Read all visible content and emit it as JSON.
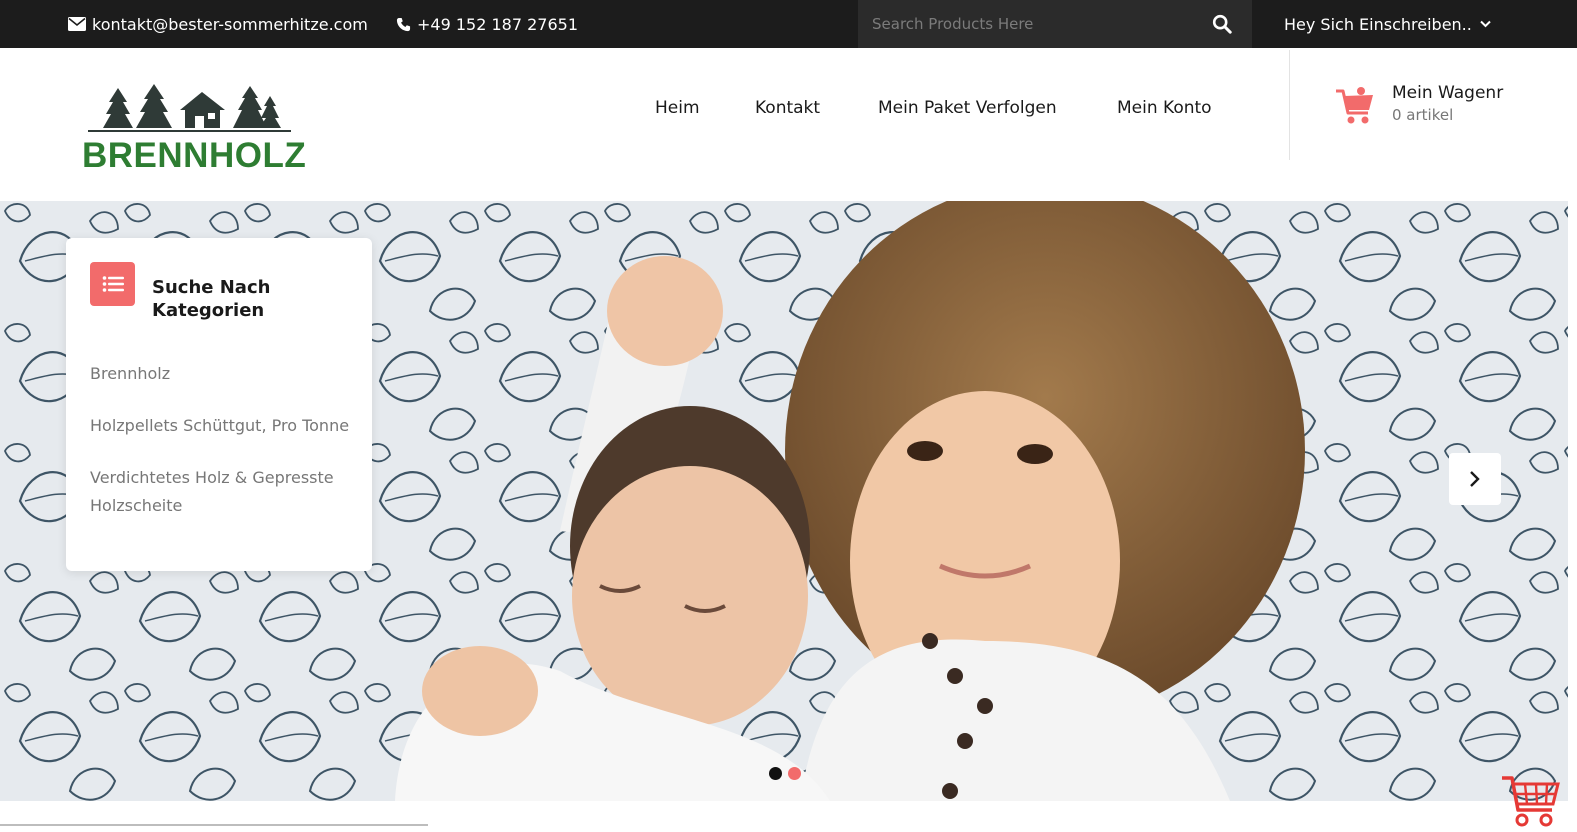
{
  "topbar": {
    "email": "kontakt@bester-sommerhitze.com",
    "phone": "+49 152 187 27651",
    "search_placeholder": "Search Products Here",
    "signup_label": "Hey Sich Einschreiben.."
  },
  "header": {
    "logo_text": "BRENNHOLZ",
    "nav": [
      "Heim",
      "Kontakt",
      "Mein Paket Verfolgen",
      "Mein Konto"
    ],
    "cart_title": "Mein Wagenr",
    "cart_count": "0 artikel"
  },
  "categories": {
    "title": "Suche Nach Kategorien",
    "items": [
      "Brennholz",
      "Holzpellets Schüttgut, Pro Tonne",
      "Verdichtetes Holz & Gepresste Holzscheite"
    ]
  },
  "slider": {
    "active_dot": 1,
    "dot_count": 2
  },
  "colors": {
    "accent": "#f26b6b",
    "topbar": "#1c1c1c",
    "logo_green": "#2e7d32",
    "logo_trees": "#2f3a37"
  },
  "icons": [
    "envelope-icon",
    "phone-icon",
    "search-icon",
    "chevron-down-icon",
    "cart-icon",
    "list-icon",
    "chevron-right-icon"
  ]
}
